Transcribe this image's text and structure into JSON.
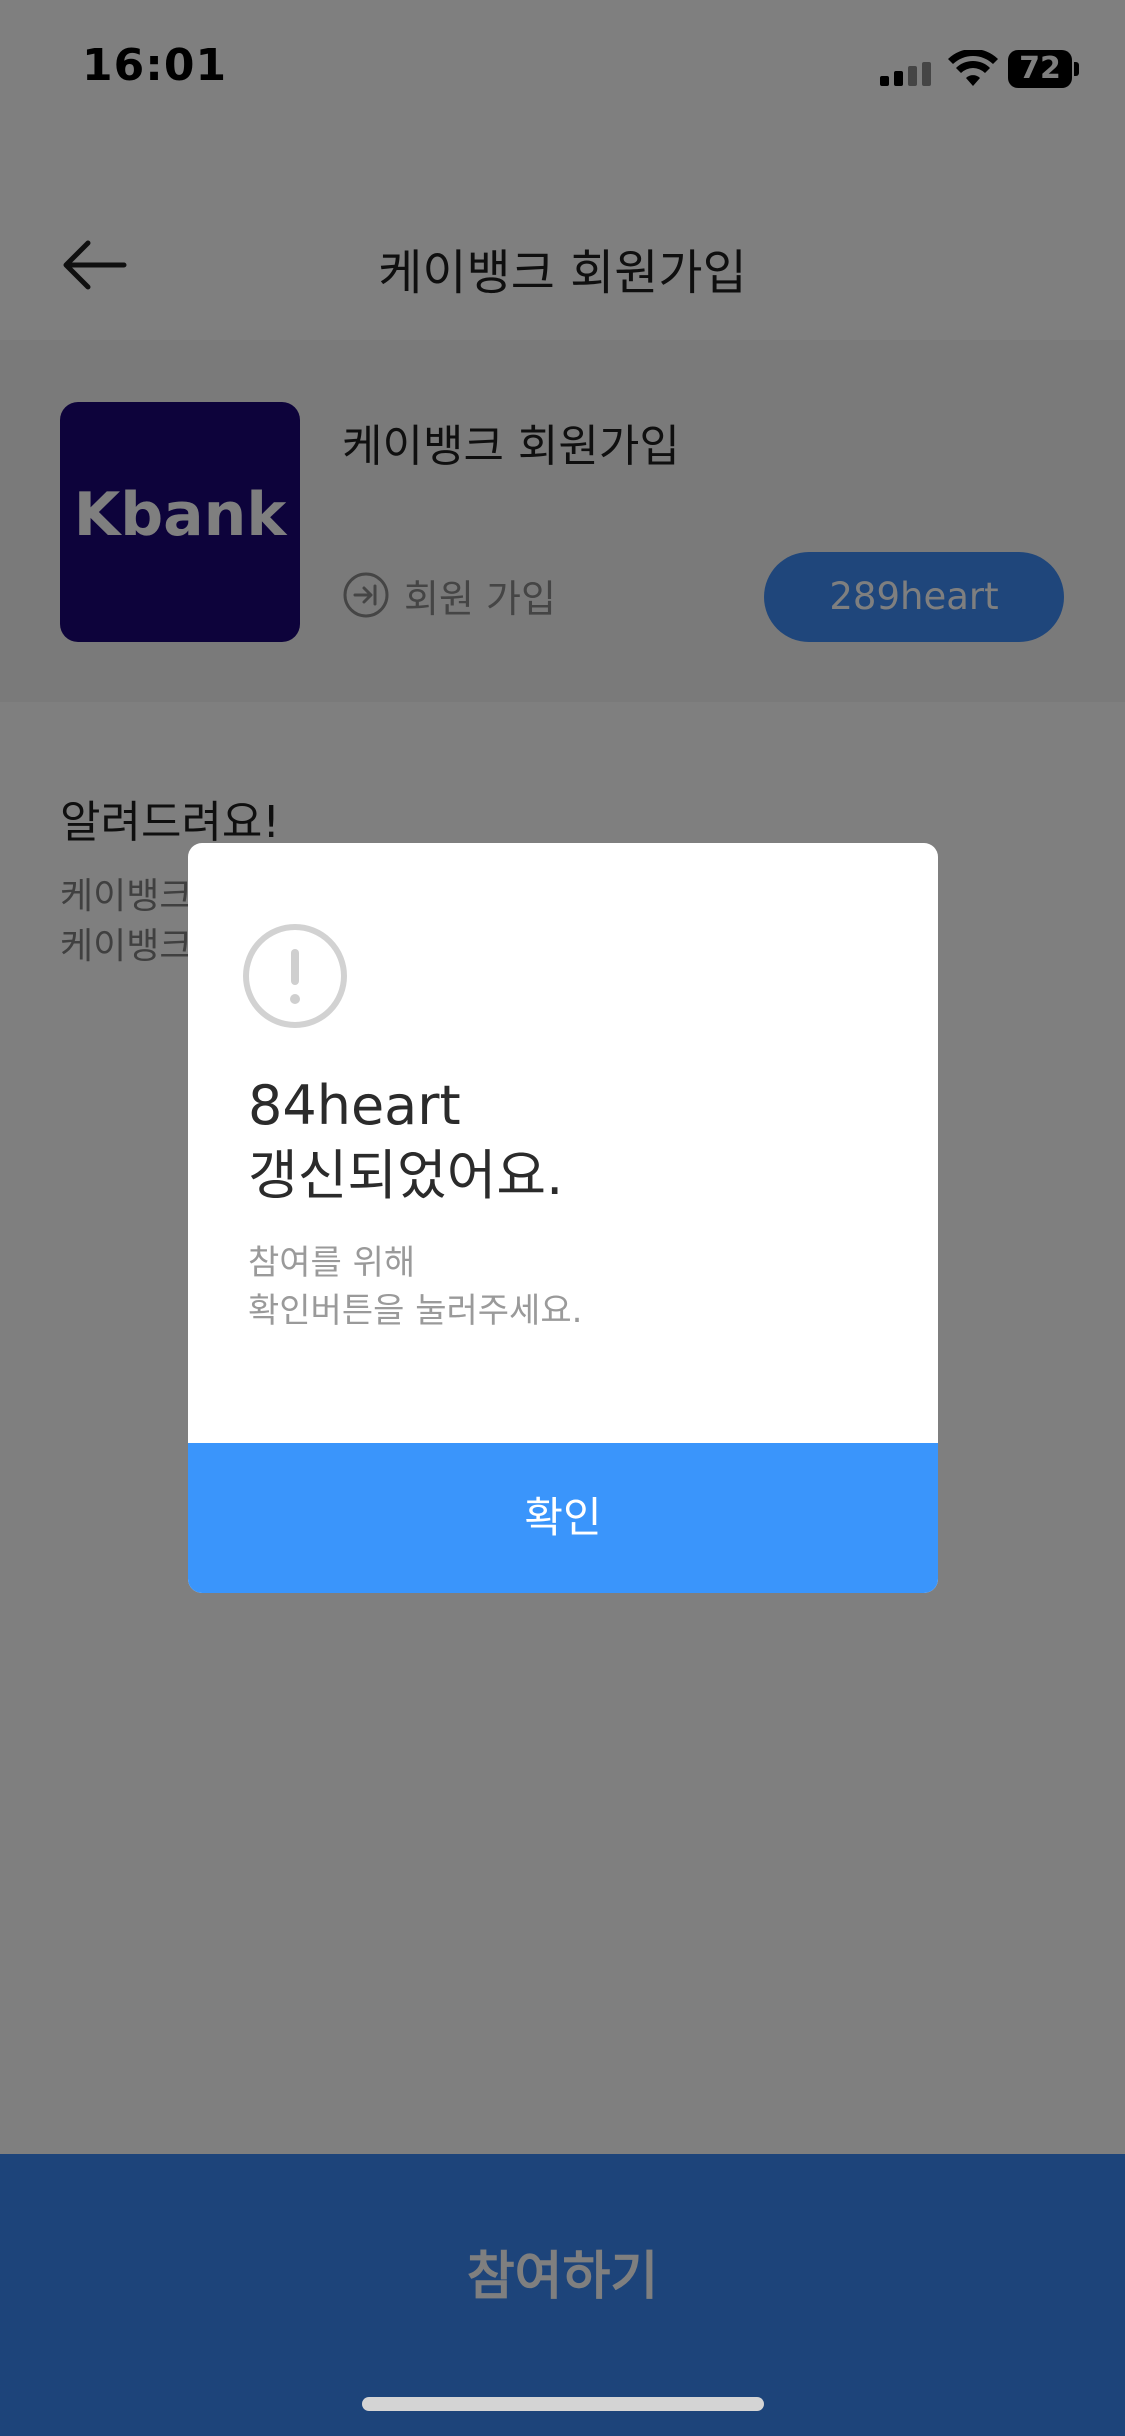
{
  "status_bar": {
    "time": "16:01",
    "battery_level": "72"
  },
  "app_bar": {
    "title": "케이뱅크 회원가입",
    "back_icon": "arrow-left-icon"
  },
  "mission": {
    "brand_logo_text": "Kbank",
    "brand_color": "#1a0777",
    "title": "케이뱅크 회원가입",
    "type_icon": "login-arrow-icon",
    "type_label": "회원 가입",
    "reward": "289heart"
  },
  "notice": {
    "title": "알려드려요!",
    "lines": [
      "케이뱅크",
      "케이뱅크"
    ]
  },
  "cta": {
    "label": "참여하기"
  },
  "dialog": {
    "icon": "alert-circle-icon",
    "headline_line1": "84heart",
    "headline_line2": "갱신되었어요.",
    "desc_line1": "참여를 위해",
    "desc_line2": "확인버튼을 눌러주세요.",
    "confirm_label": "확인"
  },
  "colors": {
    "accent": "#3e8df7",
    "confirm": "#3a95fb",
    "overlay": "rgba(0,0,0,0.5)"
  }
}
